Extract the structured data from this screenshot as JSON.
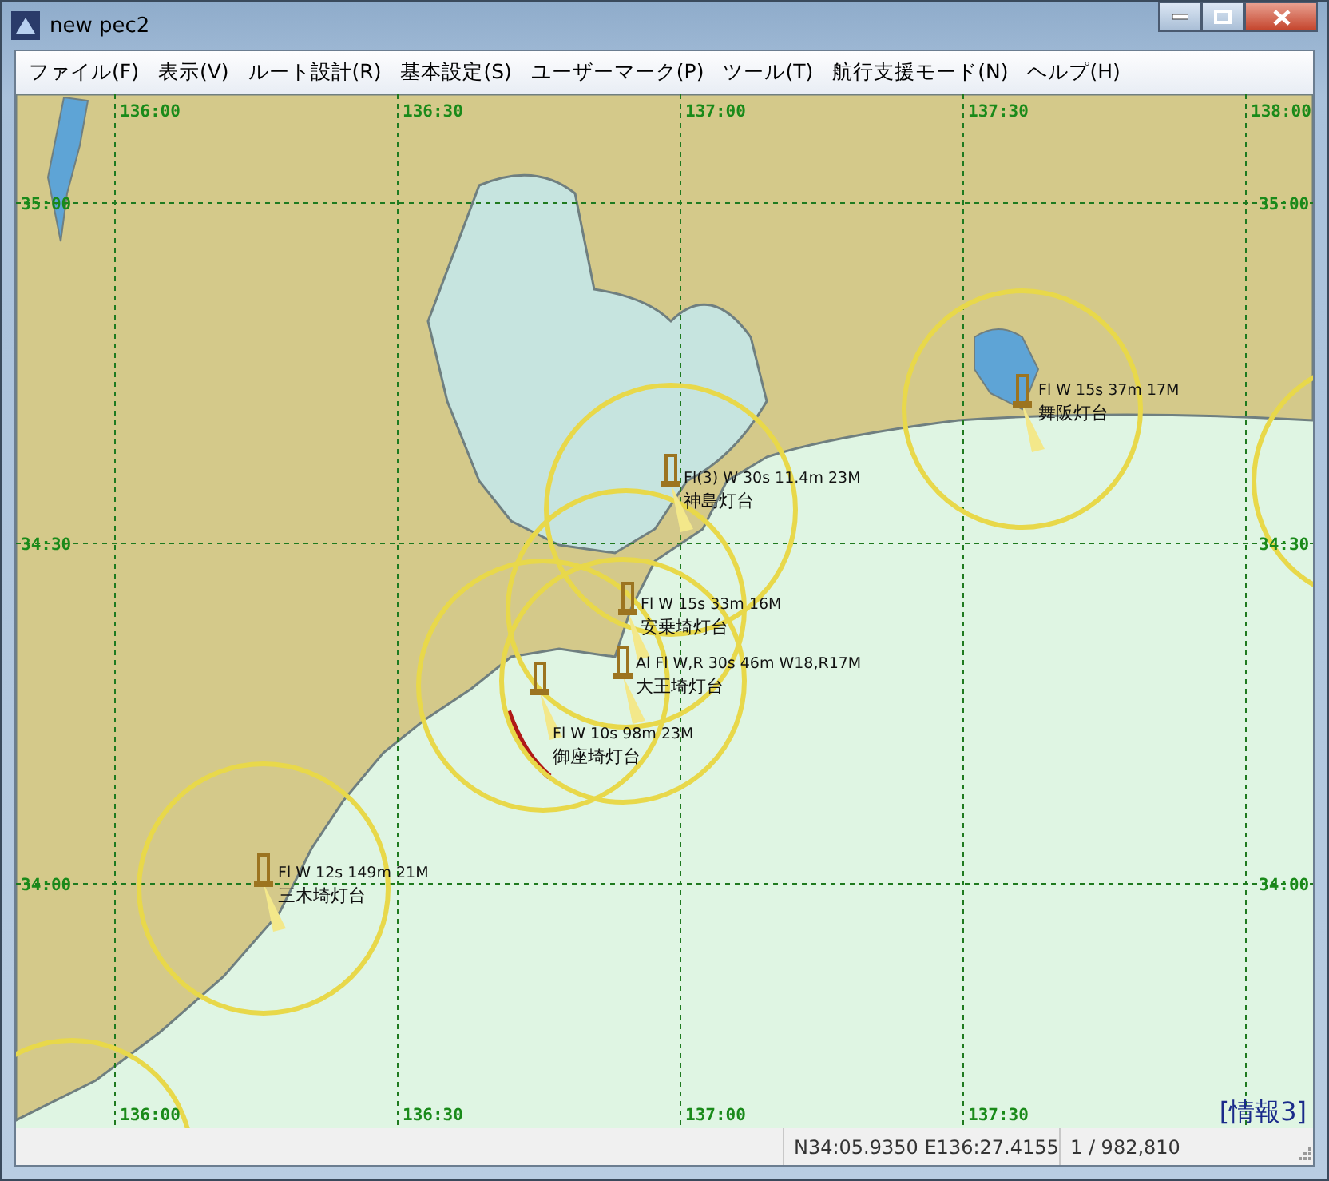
{
  "window": {
    "title": "new pec2"
  },
  "menu": [
    "ファイル(F)",
    "表示(V)",
    "ルート設計(R)",
    "基本設定(S)",
    "ユーザーマーク(P)",
    "ツール(T)",
    "航行支援モード(N)",
    "ヘルプ(H)"
  ],
  "chart": {
    "top_labels": [
      "136:00",
      "136:30",
      "137:00",
      "137:30",
      "138:00"
    ],
    "left_labels": [
      "35:00",
      "34:30",
      "34:00"
    ],
    "right_labels": [
      "35:00",
      "34:30",
      "34:00"
    ],
    "bottom_labels": [
      "136:00",
      "136:30",
      "137:00",
      "137:30"
    ],
    "lights": [
      {
        "characteristic": "Fl W 15s 37m 17M",
        "name": "舞阪灯台"
      },
      {
        "characteristic": "Fl(3) W 30s 11.4m 23M",
        "name": "神島灯台"
      },
      {
        "characteristic": "Fl W 15s 33m 16M",
        "name": "安乗埼灯台"
      },
      {
        "characteristic": "Al Fl W,R 30s 46m W18,R17M",
        "name": "大王埼灯台"
      },
      {
        "characteristic": "Fl W 10s 98m 23M",
        "name": "御座埼灯台"
      },
      {
        "characteristic": "Fl W 12s 149m 21M",
        "name": "三木埼灯台"
      }
    ],
    "info": "[情報3]"
  },
  "status_bar": {
    "position": "N34:05.9350 E136:27.4155",
    "scale": "1 / 982,810"
  }
}
